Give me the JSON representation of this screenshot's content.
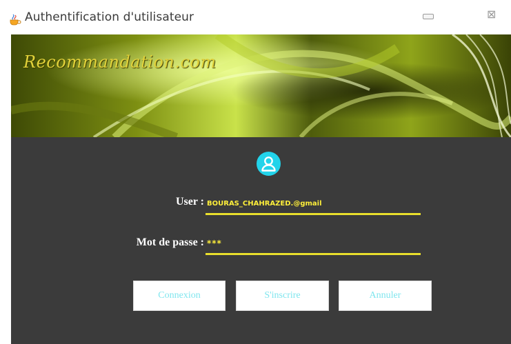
{
  "window": {
    "title": "Authentification d'utilisateur",
    "icon": "java-cup-icon",
    "minimize_icon": "minimize-icon",
    "close_symbol": "⊠"
  },
  "banner": {
    "brand": "Recommandation.com"
  },
  "form": {
    "avatar_icon": "user-icon",
    "user_label": "User :",
    "user_value": "BOURAS_CHAHRAZED.@gmail",
    "password_label": "Mot de passe :",
    "password_value": "***"
  },
  "buttons": {
    "connect": "Connexion",
    "register": "S'inscrire",
    "cancel": "Annuler"
  },
  "colors": {
    "panel": "#3b3b3b",
    "underline": "#e9df2c",
    "avatar": "#22d3ea",
    "button_text": "#7fe6ee",
    "brand_text": "#e2d23a"
  }
}
